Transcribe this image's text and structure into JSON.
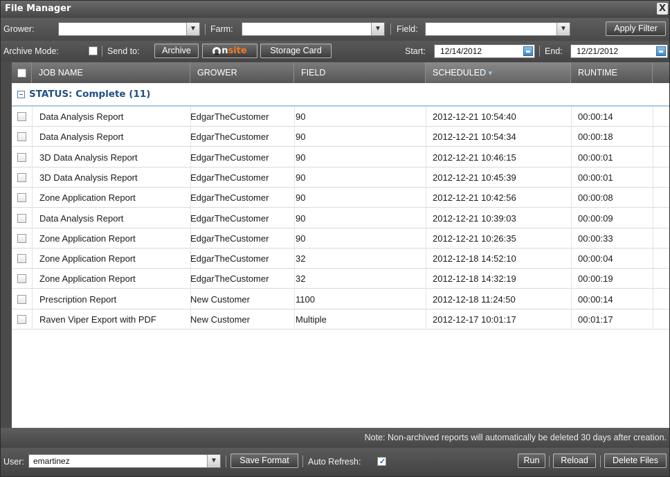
{
  "window": {
    "title": "File Manager",
    "close_glyph": "X"
  },
  "filters": {
    "grower_label": "Grower:",
    "farm_label": "Farm:",
    "field_label": "Field:",
    "apply_filter": "Apply Filter"
  },
  "toolbar": {
    "archive_mode_label": "Archive Mode:",
    "send_to_label": "Send to:",
    "archive_button": "Archive",
    "onsite_on": "n",
    "onsite_site": "site",
    "storage_card_button": "Storage Card",
    "start_label": "Start:",
    "start_date": "12/14/2012",
    "end_label": "End:",
    "end_date": "12/21/2012"
  },
  "grid": {
    "columns": [
      "JOB NAME",
      "GROWER",
      "FIELD",
      "SCHEDULED",
      "RUNTIME"
    ],
    "sort_indicator": "▾",
    "group_title": "STATUS: Complete (11)",
    "rows": [
      {
        "job": "Data Analysis Report",
        "grower": "EdgarTheCustomer",
        "field": "90",
        "scheduled": "2012-12-21 10:54:40",
        "runtime": "00:00:14"
      },
      {
        "job": "Data Analysis Report",
        "grower": "EdgarTheCustomer",
        "field": "90",
        "scheduled": "2012-12-21 10:54:34",
        "runtime": "00:00:18"
      },
      {
        "job": "3D Data Analysis Report",
        "grower": "EdgarTheCustomer",
        "field": "90",
        "scheduled": "2012-12-21 10:46:15",
        "runtime": "00:00:01"
      },
      {
        "job": "3D Data Analysis Report",
        "grower": "EdgarTheCustomer",
        "field": "90",
        "scheduled": "2012-12-21 10:45:39",
        "runtime": "00:00:01"
      },
      {
        "job": "Zone Application Report",
        "grower": "EdgarTheCustomer",
        "field": "90",
        "scheduled": "2012-12-21 10:42:56",
        "runtime": "00:00:08"
      },
      {
        "job": "Data Analysis Report",
        "grower": "EdgarTheCustomer",
        "field": "90",
        "scheduled": "2012-12-21 10:39:03",
        "runtime": "00:00:09"
      },
      {
        "job": "Zone Application Report",
        "grower": "EdgarTheCustomer",
        "field": "90",
        "scheduled": "2012-12-21 10:26:35",
        "runtime": "00:00:33"
      },
      {
        "job": "Zone Application Report",
        "grower": "EdgarTheCustomer",
        "field": "32",
        "scheduled": "2012-12-18 14:52:10",
        "runtime": "00:00:04"
      },
      {
        "job": "Zone Application Report",
        "grower": "EdgarTheCustomer",
        "field": "32",
        "scheduled": "2012-12-18 14:32:19",
        "runtime": "00:00:19"
      },
      {
        "job": "Prescription Report",
        "grower": "New Customer",
        "field": "1100",
        "scheduled": "2012-12-18 11:24:50",
        "runtime": "00:00:14"
      },
      {
        "job": "Raven Viper Export with PDF",
        "grower": "New Customer",
        "field": "Multiple",
        "scheduled": "2012-12-17 10:01:17",
        "runtime": "00:01:17"
      }
    ]
  },
  "note": "Note: Non-archived reports will automatically be deleted 30 days after creation.",
  "footer": {
    "user_label": "User:",
    "user_value": "emartinez",
    "save_format": "Save Format",
    "auto_refresh_label": "Auto Refresh:",
    "auto_refresh_tick": "✓",
    "run": "Run",
    "reload": "Reload",
    "delete_files": "Delete Files"
  },
  "colors": {
    "group_title": "#1f4f86",
    "onsite_accent": "#f47a20",
    "chrome": "#4a4a4a"
  }
}
